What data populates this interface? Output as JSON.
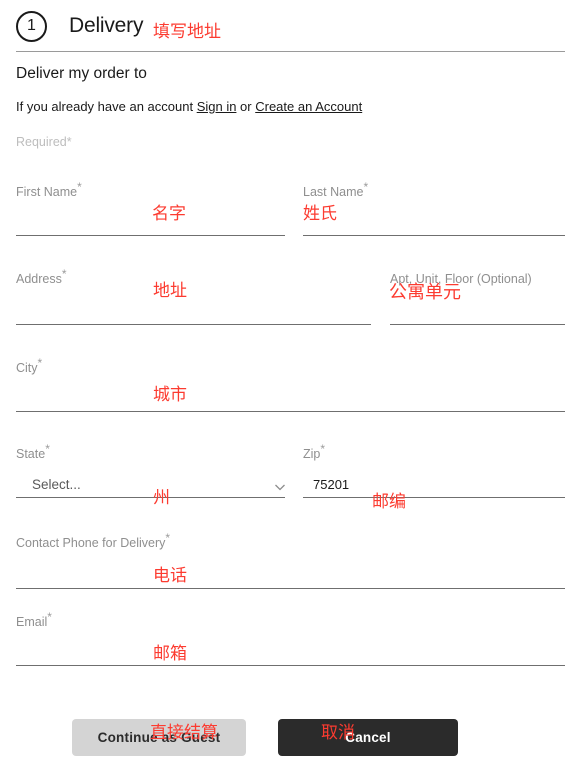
{
  "step": {
    "number": "1",
    "title": "Delivery",
    "annotation": "填写地址"
  },
  "section": {
    "heading": "Deliver my order to",
    "account_prefix": "If you already have an account ",
    "sign_in_label": "Sign in",
    "account_or": " or ",
    "create_account_label": "Create an Account",
    "required_note": "Required*"
  },
  "fields": {
    "first_name": {
      "label": "First Name",
      "required_mark": "*",
      "value": "",
      "annotation": "名字"
    },
    "last_name": {
      "label": "Last Name",
      "required_mark": "*",
      "value": "",
      "annotation": "姓氏"
    },
    "address": {
      "label": "Address",
      "required_mark": "*",
      "value": "",
      "annotation": "地址"
    },
    "apt": {
      "label": "Apt, Unit, Floor (Optional)",
      "required_mark": "",
      "value": "",
      "annotation": "公寓单元"
    },
    "city": {
      "label": "City",
      "required_mark": "*",
      "value": "",
      "annotation": "城市"
    },
    "state": {
      "label": "State",
      "required_mark": "*",
      "value": "Select...",
      "annotation": "州",
      "icon": "chevron-down-icon"
    },
    "zip": {
      "label": "Zip",
      "required_mark": "*",
      "value": "75201",
      "annotation": "邮编"
    },
    "phone": {
      "label": "Contact Phone for Delivery",
      "required_mark": "*",
      "value": "",
      "annotation": "电话"
    },
    "email": {
      "label": "Email",
      "required_mark": "*",
      "value": "",
      "annotation": "邮箱"
    }
  },
  "buttons": {
    "continue_guest": {
      "label": "Continue as Guest",
      "annotation": "直接结算"
    },
    "cancel": {
      "label": "Cancel",
      "annotation": "取消"
    }
  },
  "colors": {
    "annotation_red": "#fc3b30",
    "label_gray": "#8f8f8f",
    "line_gray": "#6f6f6f",
    "cancel_dark": "#2b2b2b",
    "guest_gray": "#d4d4d4"
  }
}
